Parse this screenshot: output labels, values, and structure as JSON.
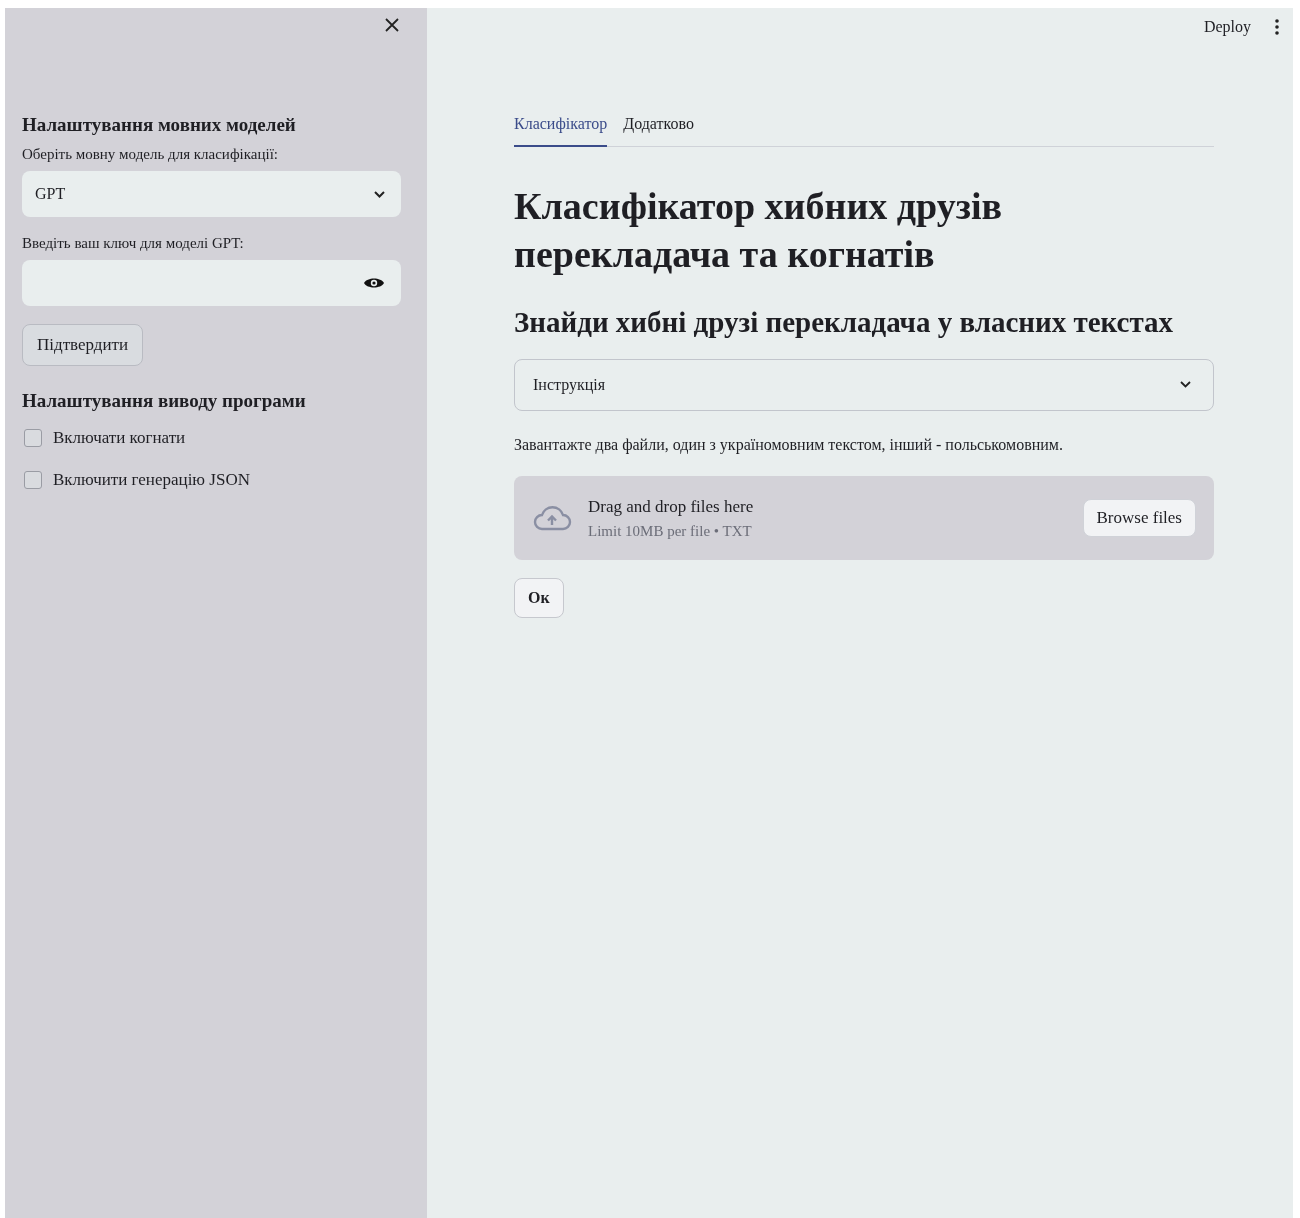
{
  "header": {
    "deploy": "Deploy"
  },
  "sidebar": {
    "sections": [
      {
        "title": "Налаштування мовних моделей"
      },
      {
        "title": "Налаштування виводу програми"
      }
    ],
    "model_select": {
      "label": "Оберіть мовну модель для класифікації:",
      "value": "GPT"
    },
    "key_field": {
      "label": "Введіть ваш ключ для моделі GPT:"
    },
    "confirm_button": "Підтвердити",
    "checkboxes": [
      {
        "label": "Включати когнати",
        "checked": false
      },
      {
        "label": "Включити генерацію JSON",
        "checked": false
      }
    ]
  },
  "tabs": [
    {
      "label": "Класифікатор",
      "selected": true
    },
    {
      "label": "Додатково",
      "selected": false
    }
  ],
  "title": "Класифікатор хибних друзів перекладача та когнатів",
  "subtitle": "Знайди хибні друзі перекладача у власних текстах",
  "expander": {
    "label": "Інструкція",
    "expanded": false
  },
  "instructions": "Завантажте два файли, один з україномовним текстом, інший - польськомовним.",
  "uploader": {
    "title": "Drag and drop files here",
    "hint": "Limit 10MB per file • TXT",
    "button": "Browse files"
  },
  "ok_button": "Ок"
}
